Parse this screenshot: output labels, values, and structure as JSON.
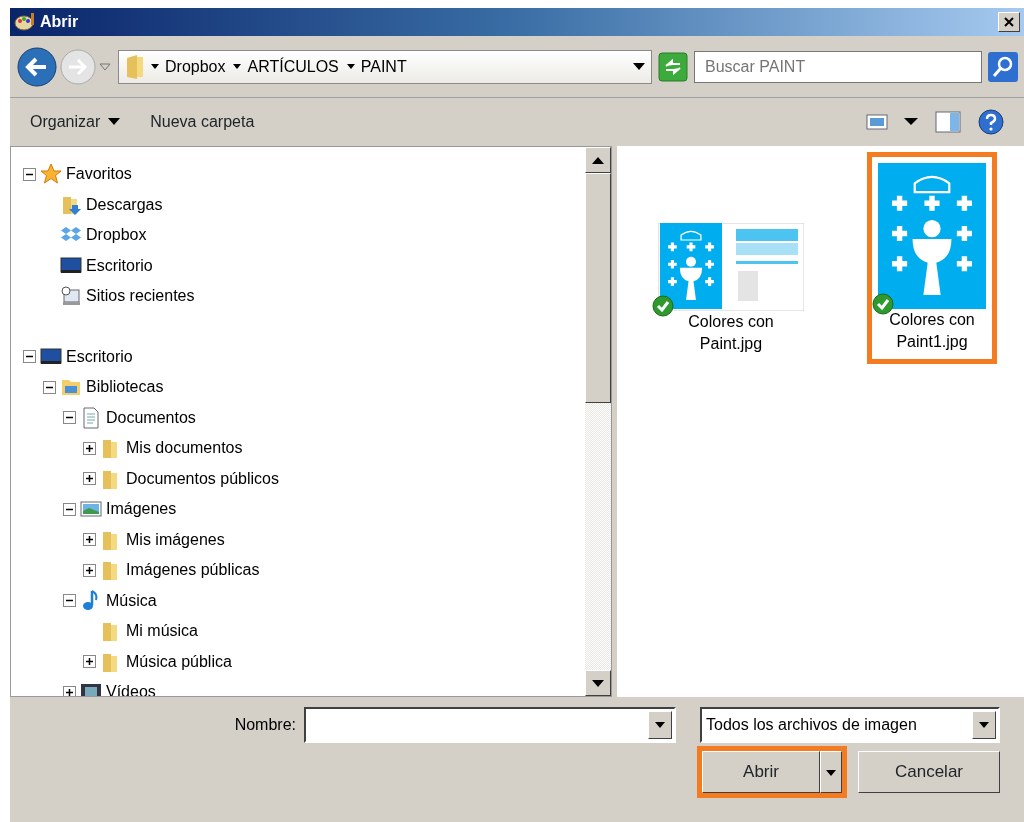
{
  "window": {
    "title": "Abrir"
  },
  "address": {
    "segments": [
      "Dropbox",
      "ARTÍCULOS",
      "PAINT"
    ]
  },
  "search": {
    "placeholder": "Buscar PAINT"
  },
  "toolbar": {
    "organize": "Organizar",
    "new_folder": "Nueva carpeta"
  },
  "tree": [
    {
      "label": "Favoritos",
      "kind": "favorites",
      "expandable": true,
      "expanded": true,
      "children": [
        {
          "label": "Descargas",
          "kind": "downloads",
          "expandable": false
        },
        {
          "label": "Dropbox",
          "kind": "cloud",
          "expandable": false
        },
        {
          "label": "Escritorio",
          "kind": "desktop",
          "expandable": false
        },
        {
          "label": "Sitios recientes",
          "kind": "recent",
          "expandable": false
        }
      ]
    },
    {
      "label": "Escritorio",
      "kind": "desktop",
      "expandable": true,
      "expanded": true,
      "children": [
        {
          "label": "Bibliotecas",
          "kind": "libraries",
          "expandable": true,
          "expanded": true,
          "children": [
            {
              "label": "Documentos",
              "kind": "documents",
              "expandable": true,
              "expanded": true,
              "children": [
                {
                  "label": "Mis documentos",
                  "kind": "folder",
                  "expandable": true,
                  "expanded": false
                },
                {
                  "label": "Documentos públicos",
                  "kind": "folder",
                  "expandable": true,
                  "expanded": false
                }
              ]
            },
            {
              "label": "Imágenes",
              "kind": "pictures",
              "expandable": true,
              "expanded": true,
              "children": [
                {
                  "label": "Mis imágenes",
                  "kind": "folder",
                  "expandable": true,
                  "expanded": false
                },
                {
                  "label": "Imágenes públicas",
                  "kind": "folder",
                  "expandable": true,
                  "expanded": false
                }
              ]
            },
            {
              "label": "Música",
              "kind": "music",
              "expandable": true,
              "expanded": true,
              "children": [
                {
                  "label": "Mi música",
                  "kind": "folder",
                  "expandable": false
                },
                {
                  "label": "Música pública",
                  "kind": "folder",
                  "expandable": true,
                  "expanded": false
                }
              ]
            },
            {
              "label": "Vídeos",
              "kind": "videos",
              "expandable": true,
              "expanded": false
            }
          ]
        }
      ]
    }
  ],
  "files": [
    {
      "line1": "Colores con",
      "line2": "Paint.jpg",
      "kind": "sheet",
      "selected": false
    },
    {
      "line1": "Colores con",
      "line2": "Paint1.jpg",
      "kind": "emblem",
      "selected": true
    }
  ],
  "footer": {
    "name_label": "Nombre:",
    "filter": "Todos los archivos de imagen",
    "open": "Abrir",
    "open_highlighted": true,
    "cancel": "Cancelar"
  }
}
